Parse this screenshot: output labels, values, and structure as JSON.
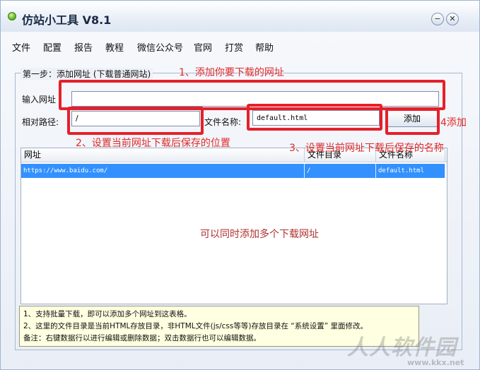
{
  "window": {
    "title": "仿站小工具 V8.1"
  },
  "menu": [
    "文件",
    "配置",
    "报告",
    "教程",
    "微信公众号",
    "官网",
    "打赏",
    "帮助"
  ],
  "step": {
    "legend": "第一步：添加网址 (下载普通网站)"
  },
  "form": {
    "url_label": "输入网址",
    "url_value": "",
    "path_label": "相对路径:",
    "path_value": "/",
    "filename_label": "文件名称:",
    "filename_value": "default.html",
    "add_button": "添加"
  },
  "table": {
    "headers": [
      "网址",
      "文件目录",
      "文件名称"
    ],
    "rows": [
      {
        "url": "https://www.baidu.com/",
        "dir": "/",
        "file": "default.html"
      }
    ]
  },
  "tips": [
    "1、支持批量下载，即可以添加多个网址到这表格。",
    "2、这里的文件目录是当前HTML存放目录，非HTML文件(js/css等等)存放目录在 “系统设置” 里面修改。",
    "备注：右键数据行以进行编辑或删除数据；双击数据行也可以编辑数据。"
  ],
  "annotations": {
    "a1": "1、添加你要下载的网址",
    "a2": "2、设置当前网址下载后保存的位置",
    "a3": "3、设置当前网址下载后保存的名称",
    "a4": "4添加",
    "multi": "可以同时添加多个下载网址"
  },
  "watermark": {
    "text": "人人软件园",
    "url": "www.kkx.net"
  },
  "colors": {
    "annotation_red": "#e5202a",
    "selection_blue": "#3391ff"
  }
}
